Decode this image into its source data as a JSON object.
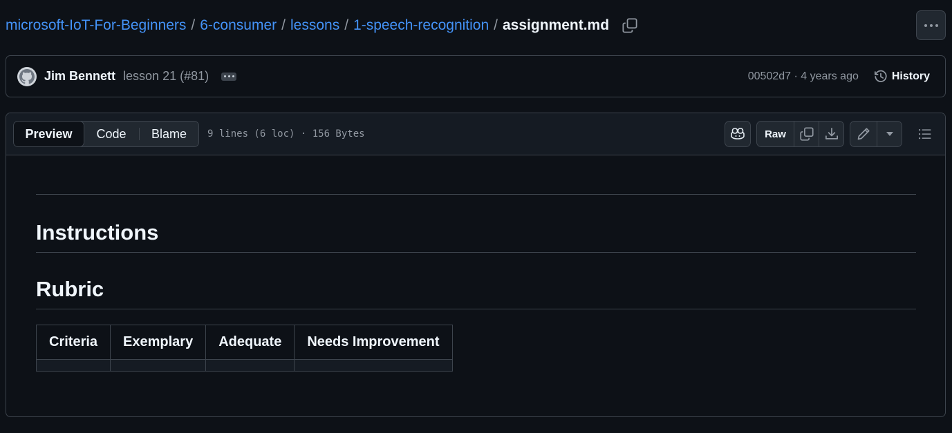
{
  "breadcrumb": {
    "items": [
      "microsoft-IoT-For-Beginners",
      "6-consumer",
      "lessons",
      "1-speech-recognition"
    ],
    "separator": "/",
    "current": "assignment.md"
  },
  "commit": {
    "author": "Jim Bennett",
    "message": "lesson 21 (#81)",
    "sha_time": "00502d7 · 4 years ago",
    "history_label": "History"
  },
  "file_header": {
    "tabs": [
      "Preview",
      "Code",
      "Blame"
    ],
    "active_tab": "Preview",
    "meta": "9 lines (6 loc) · 156 Bytes",
    "raw_label": "Raw"
  },
  "content": {
    "heading_1": "Instructions",
    "heading_2": "Rubric",
    "table_headers": [
      "Criteria",
      "Exemplary",
      "Adequate",
      "Needs Improvement"
    ]
  },
  "colors": {
    "background": "#0d1117",
    "link": "#4493f8",
    "border": "#3d444d",
    "muted": "#9198a1",
    "text": "#f0f6fc"
  },
  "icons": [
    "copy-icon",
    "kebab-horizontal-icon",
    "github-avatar-icon",
    "history-icon",
    "copilot-icon",
    "download-icon",
    "pencil-icon",
    "triangle-down-icon",
    "list-unordered-icon"
  ]
}
